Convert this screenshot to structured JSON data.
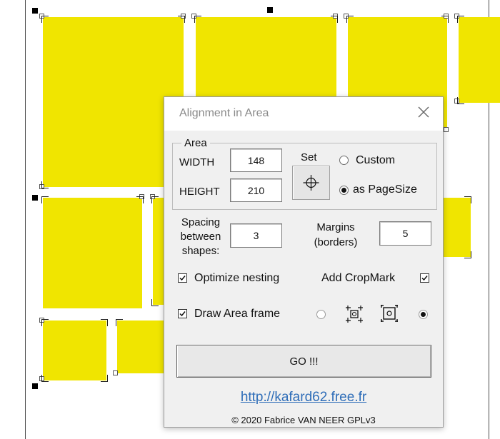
{
  "dialog": {
    "title": "Alignment in Area",
    "close_icon": "close-icon",
    "area_group_label": "Area",
    "width_label": "WIDTH",
    "width_value": "148",
    "height_label": "HEIGHT",
    "height_value": "210",
    "set_label": "Set",
    "set_icon": "crosshair-icon",
    "custom_label": "Custom",
    "pagesize_label": "as PageSize",
    "size_mode_selected": "as PageSize",
    "spacing_label_line1": "Spacing",
    "spacing_label_line2": "between",
    "spacing_label_line3": "shapes:",
    "spacing_value": "3",
    "margins_label_line1": "Margins",
    "margins_label_line2": "(borders)",
    "margins_value": "5",
    "optimize_label": "Optimize nesting",
    "optimize_checked": true,
    "cropmark_label": "Add CropMark",
    "cropmark_checked": true,
    "frame_label": "Draw Area frame",
    "frame_checked": true,
    "crop_mode_selected": "outer",
    "go_label": "GO !!!",
    "link": "http://kafard62.free.fr",
    "copyright": "© 2020 Fabrice VAN NEER GPLv3"
  },
  "colors": {
    "shape_fill": "#f0e500",
    "link": "#2e6db8",
    "dialog_bg": "#f0f0f0"
  }
}
